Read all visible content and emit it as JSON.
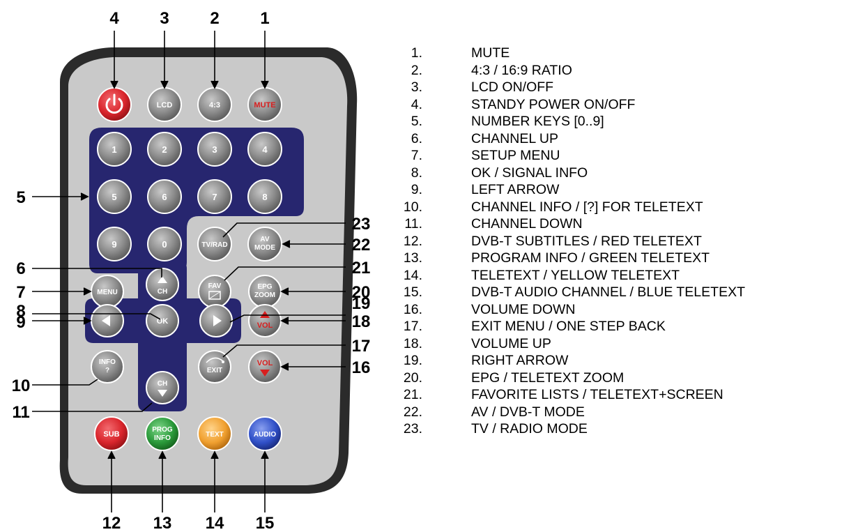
{
  "colors": {
    "casing": "#2b2b2b",
    "face": "#c9c9c9",
    "panel": "#27266f",
    "button_gray": "#8f8f8f",
    "power": "#d9252c",
    "mute_text": "#d81f1f",
    "sub": "#d9252c",
    "prog_info": "#2a9a3a",
    "text": "#f0a030",
    "audio": "#3050c8"
  },
  "icons": [
    "power-icon",
    "up-arrow-icon",
    "down-arrow-icon",
    "left-arrow-icon",
    "right-arrow-icon",
    "fav-screen-icon",
    "exit-arc-icon"
  ],
  "buttons": {
    "lcd": "LCD",
    "ratio": "4:3",
    "mute": "MUTE",
    "digits": [
      "1",
      "2",
      "3",
      "4",
      "5",
      "6",
      "7",
      "8",
      "9",
      "0"
    ],
    "tv_rad": "TV/RAD",
    "av_mode_1": "AV",
    "av_mode_2": "MODE",
    "menu": "MENU",
    "ch_up": "CH",
    "fav": "FAV",
    "epg_1": "EPG",
    "epg_2": "ZOOM",
    "ok": "OK",
    "vol_up": "VOL",
    "info_1": "INFO",
    "info_2": "?",
    "ch_down": "CH",
    "exit": "EXIT",
    "vol_down": "VOL",
    "sub": "SUB",
    "prog_1": "PROG",
    "prog_2": "INFO",
    "text": "TEXT",
    "audio": "AUDIO"
  },
  "callouts": {
    "n1": "1",
    "n2": "2",
    "n3": "3",
    "n4": "4",
    "n5": "5",
    "n6": "6",
    "n7": "7",
    "n8": "8",
    "n9": "9",
    "n10": "10",
    "n11": "11",
    "n12": "12",
    "n13": "13",
    "n14": "14",
    "n15": "15",
    "n16": "16",
    "n17": "17",
    "n18": "18",
    "n19": "19",
    "n20": "20",
    "n21": "21",
    "n22": "22",
    "n23": "23"
  },
  "legend": [
    {
      "num": "1.",
      "text": "MUTE"
    },
    {
      "num": "2.",
      "text": "4:3 / 16:9 RATIO"
    },
    {
      "num": "3.",
      "text": "LCD ON/OFF"
    },
    {
      "num": "4.",
      "text": "STANDY POWER ON/OFF"
    },
    {
      "num": "5.",
      "text": "NUMBER KEYS [0..9]"
    },
    {
      "num": "6.",
      "text": "CHANNEL UP"
    },
    {
      "num": "7.",
      "text": "SETUP MENU"
    },
    {
      "num": "8.",
      "text": "OK / SIGNAL INFO"
    },
    {
      "num": "9.",
      "text": "LEFT ARROW"
    },
    {
      "num": "10.",
      "text": "CHANNEL INFO / [?] FOR TELETEXT"
    },
    {
      "num": "11.",
      "text": "CHANNEL DOWN"
    },
    {
      "num": "12.",
      "text": "DVB-T SUBTITLES / RED TELETEXT"
    },
    {
      "num": "13.",
      "text": "PROGRAM INFO / GREEN TELETEXT"
    },
    {
      "num": "14.",
      "text": "TELETEXT / YELLOW TELETEXT"
    },
    {
      "num": "15.",
      "text": "DVB-T AUDIO CHANNEL / BLUE TELETEXT"
    },
    {
      "num": "16.",
      "text": "VOLUME DOWN"
    },
    {
      "num": "17.",
      "text": "EXIT MENU / ONE STEP BACK"
    },
    {
      "num": "18.",
      "text": "VOLUME UP"
    },
    {
      "num": "19.",
      "text": "RIGHT ARROW"
    },
    {
      "num": "20.",
      "text": "EPG / TELETEXT ZOOM"
    },
    {
      "num": "21.",
      "text": "FAVORITE LISTS / TELETEXT+SCREEN"
    },
    {
      "num": "22.",
      "text": "AV / DVB-T MODE"
    },
    {
      "num": "23.",
      "text": "TV / RADIO MODE"
    }
  ]
}
